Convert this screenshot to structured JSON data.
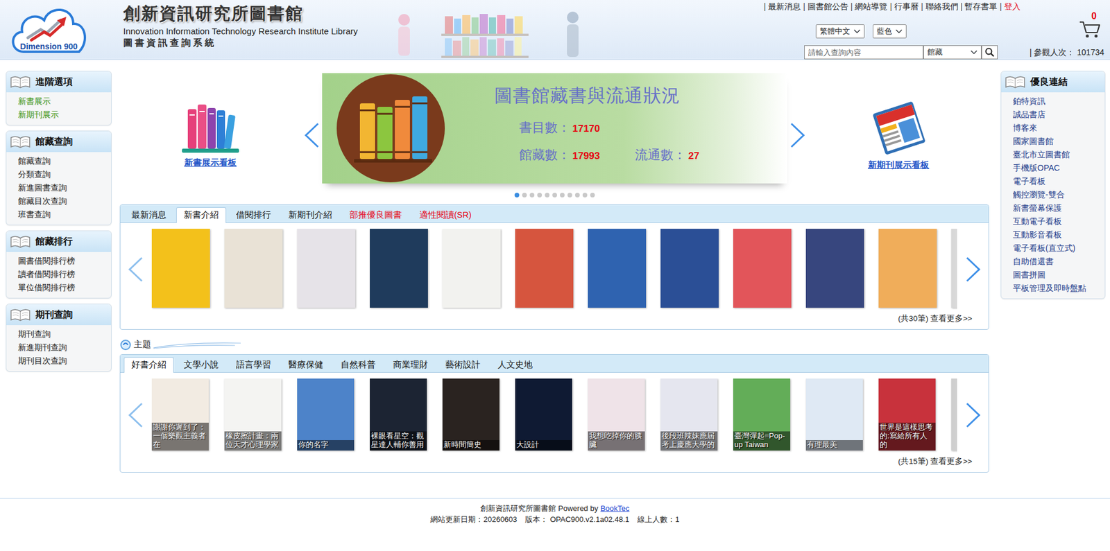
{
  "header": {
    "logo": "Dimension 900",
    "title": "創新資訊研究所圖書館",
    "title_en": "Innovation Information Technology Research Institute Library",
    "system_name": "圖書資訊查詢系統",
    "separator": "|",
    "top_links": [
      {
        "label": "最新消息",
        "color": "#222222"
      },
      {
        "label": "圖書館公告",
        "color": "#222222"
      },
      {
        "label": "網站導覽",
        "color": "#222222"
      },
      {
        "label": "行事曆",
        "color": "#222222"
      },
      {
        "label": "聯絡我們",
        "color": "#222222"
      },
      {
        "label": "暫存書單",
        "color": "#222222"
      },
      {
        "label": "登入",
        "color": "#e60012"
      }
    ],
    "language": "繁體中文",
    "theme": "藍色",
    "search": {
      "placeholder": "請輸入查詢內容",
      "scope": "館藏"
    },
    "cart_count": "0",
    "visitors": {
      "label": "參觀人次：",
      "count": "101734"
    }
  },
  "left_menu": [
    {
      "title": "進階選項",
      "items": [
        {
          "label": "新書展示",
          "highlighted": true
        },
        {
          "label": "新期刊展示",
          "highlighted": true
        }
      ]
    },
    {
      "title": "館藏查詢",
      "items": [
        {
          "label": "館藏查詢",
          "highlighted": false
        },
        {
          "label": "分類查詢",
          "highlighted": false
        },
        {
          "label": "新進圖書查詢",
          "highlighted": false
        },
        {
          "label": "館藏目次查詢",
          "highlighted": false
        },
        {
          "label": "班書查詢",
          "highlighted": false
        }
      ]
    },
    {
      "title": "館藏排行",
      "items": [
        {
          "label": "圖書借閱排行榜",
          "highlighted": false
        },
        {
          "label": "讀者借閱排行榜",
          "highlighted": false
        },
        {
          "label": "單位借閱排行榜",
          "highlighted": false
        }
      ]
    },
    {
      "title": "期刊查詢",
      "items": [
        {
          "label": "期刊查詢",
          "highlighted": false
        },
        {
          "label": "新進期刊查詢",
          "highlighted": false
        },
        {
          "label": "期刊目次查詢",
          "highlighted": false
        }
      ]
    }
  ],
  "carousel": {
    "left_board": "新書展示看板",
    "right_board": "新期刊展示看板",
    "banner": {
      "title": "圖書館藏書與流通狀況",
      "stats": [
        {
          "label": "書目數：",
          "value": "17170"
        },
        {
          "label": "館藏數：",
          "value": "17993"
        },
        {
          "label": "流通數：",
          "value": "27"
        }
      ]
    },
    "indicators": [
      {
        "selected": true
      },
      {
        "selected": false
      },
      {
        "selected": false
      },
      {
        "selected": false
      },
      {
        "selected": false
      },
      {
        "selected": false
      },
      {
        "selected": false
      },
      {
        "selected": false
      },
      {
        "selected": false
      },
      {
        "selected": false
      },
      {
        "selected": false
      }
    ]
  },
  "news_panel": {
    "tabs": [
      {
        "label": "最新消息",
        "selected": false,
        "color": "#111111"
      },
      {
        "label": "新書介紹",
        "selected": true,
        "color": "#111111"
      },
      {
        "label": "借閱排行",
        "selected": false,
        "color": "#111111"
      },
      {
        "label": "新期刊介紹",
        "selected": false,
        "color": "#111111"
      },
      {
        "label": "部推優良圖書",
        "selected": false,
        "color": "#e60012"
      },
      {
        "label": "適性閱讀(SR)",
        "selected": false,
        "color": "#e60012"
      }
    ],
    "books": [
      {
        "color": "#f3c11b"
      },
      {
        "color": "#e9e2d6"
      },
      {
        "color": "#e6e3e8"
      },
      {
        "color": "#1f3b5c"
      },
      {
        "color": "#f2f2ef"
      },
      {
        "color": "#d6553e"
      },
      {
        "color": "#2f63b0"
      },
      {
        "color": "#2b4f96"
      },
      {
        "color": "#e2555a"
      },
      {
        "color": "#37467e"
      },
      {
        "color": "#f0ad5a"
      },
      {
        "color": "#d8d8d8"
      }
    ],
    "more": "(共30筆) 查看更多>>"
  },
  "topic_panel": {
    "heading": "主題",
    "tabs": [
      {
        "label": "好書介紹",
        "selected": true
      },
      {
        "label": "文學小說",
        "selected": false
      },
      {
        "label": "語言學習",
        "selected": false
      },
      {
        "label": "醫療保健",
        "selected": false
      },
      {
        "label": "自然科普",
        "selected": false
      },
      {
        "label": "商業理財",
        "selected": false
      },
      {
        "label": "藝術設計",
        "selected": false
      },
      {
        "label": "人文史地",
        "selected": false
      }
    ],
    "books": [
      {
        "caption": "謝謝你遲到了：一個樂觀主義者在",
        "color": "#f2ebe2"
      },
      {
        "caption": "橡皮擦計畫：兩位天才心理學家",
        "color": "#f4f4f2"
      },
      {
        "caption": "你的名字",
        "color": "#4d83c9"
      },
      {
        "caption": "裸眼看星空：觀星達人輔你善用",
        "color": "#1c2433"
      },
      {
        "caption": "新時間簡史",
        "color": "#2a2320"
      },
      {
        "caption": "大設計",
        "color": "#0f1a33"
      },
      {
        "caption": "我想吃掉你的胰臟",
        "color": "#efe3e8"
      },
      {
        "caption": "後段班辣妹應屆考上慶應大學的",
        "color": "#e5e6ef"
      },
      {
        "caption": "臺灣彈起=Pop-up Taiwan",
        "color": "#63ad58"
      },
      {
        "caption": "有理最美",
        "color": "#dfe9f4"
      },
      {
        "caption": "世界是這樣思考的:寫給所有人的",
        "color": "#c8323c"
      },
      {
        "color": "#cfcfcf"
      }
    ],
    "more": "(共15筆) 查看更多>>"
  },
  "links_panel": {
    "title": "優良連結",
    "items": [
      {
        "label": "鉑特資訊"
      },
      {
        "label": "誠品書店"
      },
      {
        "label": "博客來"
      },
      {
        "label": "國家圖書館"
      },
      {
        "label": "臺北市立圖書館"
      },
      {
        "label": "手機版OPAC"
      },
      {
        "label": "電子看板"
      },
      {
        "label": "觸控瀏覽-雙合"
      },
      {
        "label": "新書螢幕保護"
      },
      {
        "label": "互動電子看板"
      },
      {
        "label": "互動影音看板"
      },
      {
        "label": "電子看板(直立式)"
      },
      {
        "label": "自助借還書"
      },
      {
        "label": "圖書拼圖"
      },
      {
        "label": "平板管理及即時盤點"
      }
    ]
  },
  "footer": {
    "credit": "創新資訊研究所圖書館 Powered by",
    "link": "BookTec",
    "updated": "網站更新日期：20260603",
    "version": "版本： OPAC900.v2.1a02.48.1",
    "online": "線上人數：1"
  }
}
